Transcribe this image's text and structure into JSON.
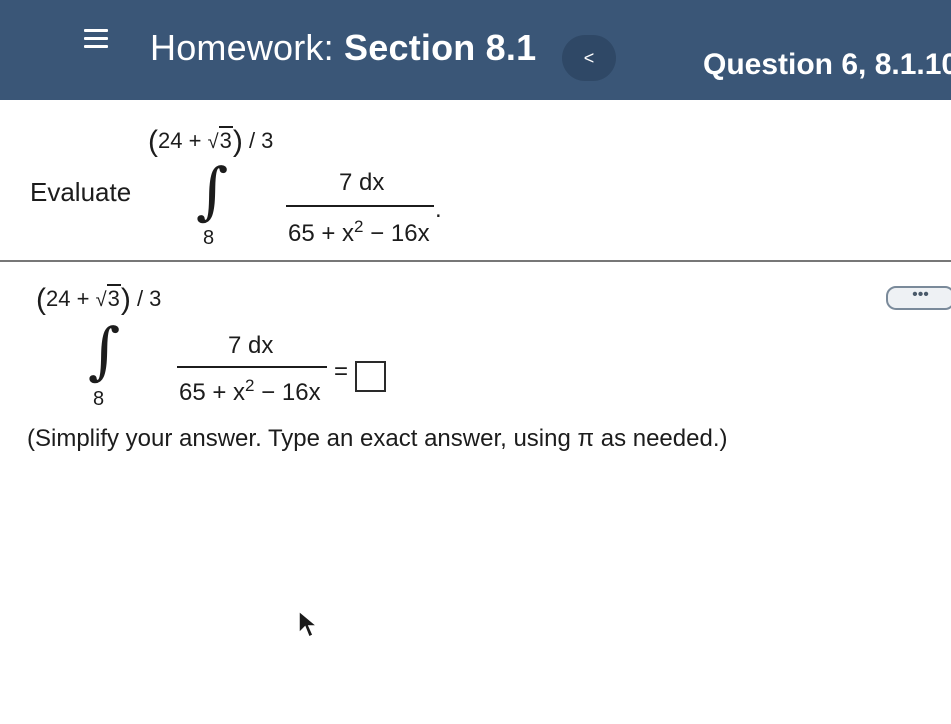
{
  "header": {
    "title_prefix": "Homework:",
    "title_section": "Section 8.1",
    "prev_label": "<",
    "question_label": "Question 6, 8.1.10"
  },
  "question": {
    "evaluate_label": "Evaluate",
    "upper_limit": {
      "open": "(",
      "a": "24",
      "plus": "+",
      "radical": "√",
      "radicand": "3",
      "close": ")",
      "divisor": "/ 3"
    },
    "lower_limit": "8",
    "numerator": "7 dx",
    "denominator": {
      "part1": "65 + x",
      "exponent": "2",
      "part2": " − 16x"
    },
    "period": "."
  },
  "answer": {
    "equals": "=",
    "more_label": "•••",
    "value": "",
    "instruction": "(Simplify your answer. Type an exact answer, using π as needed.)"
  },
  "colors": {
    "header_bg": "#3a5677",
    "header_text": "#ffffff",
    "text": "#1c1c1c"
  }
}
